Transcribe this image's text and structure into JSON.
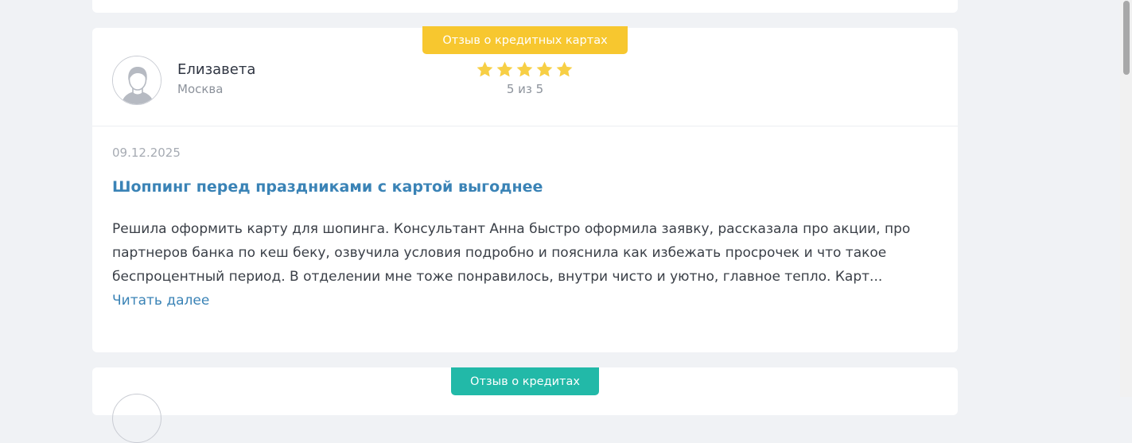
{
  "review": {
    "category": "Отзыв о кредитных картах",
    "author": {
      "name": "Елизавета",
      "city": "Москва"
    },
    "rating": {
      "value": 5,
      "max": 5,
      "text": "5 из 5"
    },
    "date": "09.12.2025",
    "title": "Шоппинг перед праздниками с картой выгоднее",
    "text": "Решила оформить карту для шопинга. Консультант Анна быстро оформила заявку, рассказала про акции, про партнеров банка по кеш беку, озвучила условия подробно и пояснила как избежать просрочек и что такое беспроцентный период. В отделении мне тоже понравилось, внутри чисто и уютно, главное тепло. Карт...",
    "read_more": "Читать далее"
  },
  "next_review": {
    "category": "Отзыв о кредитах"
  },
  "colors": {
    "badge_credit_cards": "#f7c72f",
    "badge_credits": "#22b9a8",
    "star": "#f7cf45",
    "link": "#3a83b6"
  },
  "icons": {
    "avatar": "user-avatar-icon",
    "star": "star-icon"
  }
}
